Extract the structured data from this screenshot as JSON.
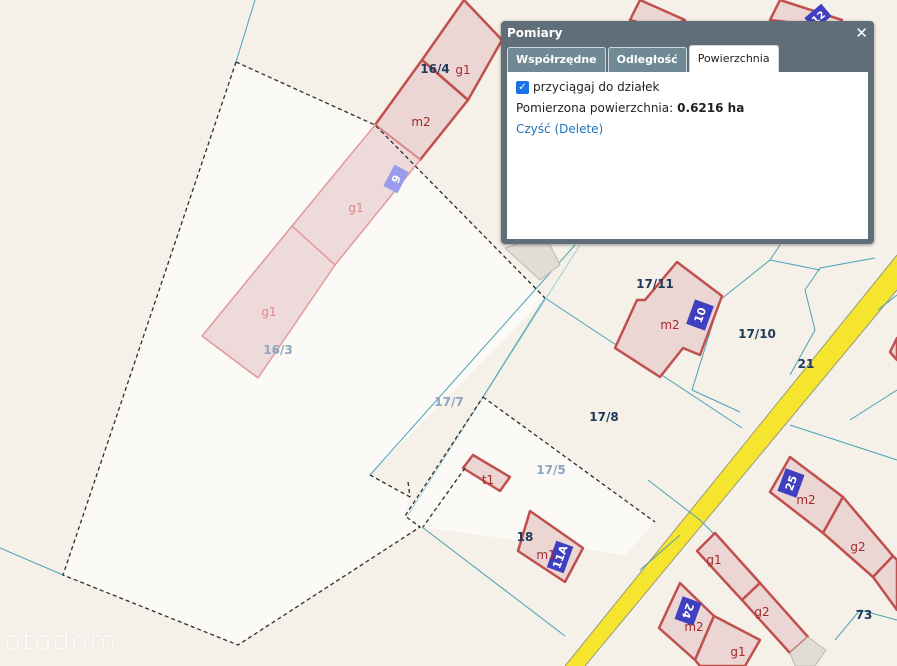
{
  "map": {
    "parcel_labels": {
      "p16_4": "16/4",
      "p16_3": "16/3",
      "p17_7": "17/7",
      "p17_8": "17/8",
      "p17_5": "17/5",
      "p17_11": "17/11",
      "p17_10": "17/10",
      "p21": "21",
      "p18": "18",
      "p73": "73"
    },
    "building_labels": {
      "g1_top": "g1",
      "m2_top": "m2",
      "g1_pink1": "g1",
      "g1_pink2": "g1",
      "m2_10": "m2",
      "t1": "t1",
      "m1": "m1",
      "m2_25": "m2",
      "g2_right": "g2",
      "g1_bottom1": "g1",
      "g2_bottom": "g2",
      "m2_24": "m2",
      "g1_bottom2": "g1"
    },
    "house_numbers": {
      "n9": "9",
      "n10": "10",
      "n11a": "11A",
      "n25": "25",
      "n24": "24",
      "n12": "12"
    },
    "colors": {
      "background": "#f5f0e8",
      "building_fill": "#ecd6d4",
      "building_stroke": "#c0504d",
      "parcel_line": "#4aa3b5",
      "road": "#f5e52e"
    }
  },
  "watermark": "otodom",
  "panel": {
    "title": "Pomiary",
    "close_icon": "close-icon",
    "tabs": [
      "Współrzędne",
      "Odległość",
      "Powierzchnia"
    ],
    "active_tab": "Powierzchnia",
    "snap_checkbox": {
      "label": "przyciągaj do działek",
      "checked": true
    },
    "result_label": "Pomierzona powierzchnia:",
    "result_value": "0.6216 ha",
    "clear_link": "Czyść (Delete)"
  }
}
